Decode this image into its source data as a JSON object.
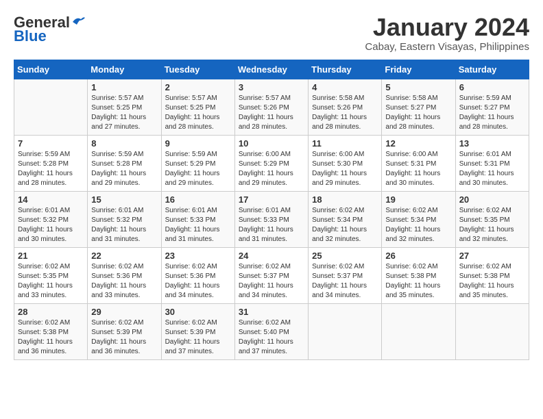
{
  "header": {
    "logo_line1": "General",
    "logo_line2": "Blue",
    "month": "January 2024",
    "location": "Cabay, Eastern Visayas, Philippines"
  },
  "weekdays": [
    "Sunday",
    "Monday",
    "Tuesday",
    "Wednesday",
    "Thursday",
    "Friday",
    "Saturday"
  ],
  "weeks": [
    [
      {
        "day": "",
        "info": ""
      },
      {
        "day": "1",
        "info": "Sunrise: 5:57 AM\nSunset: 5:25 PM\nDaylight: 11 hours\nand 27 minutes."
      },
      {
        "day": "2",
        "info": "Sunrise: 5:57 AM\nSunset: 5:25 PM\nDaylight: 11 hours\nand 28 minutes."
      },
      {
        "day": "3",
        "info": "Sunrise: 5:57 AM\nSunset: 5:26 PM\nDaylight: 11 hours\nand 28 minutes."
      },
      {
        "day": "4",
        "info": "Sunrise: 5:58 AM\nSunset: 5:26 PM\nDaylight: 11 hours\nand 28 minutes."
      },
      {
        "day": "5",
        "info": "Sunrise: 5:58 AM\nSunset: 5:27 PM\nDaylight: 11 hours\nand 28 minutes."
      },
      {
        "day": "6",
        "info": "Sunrise: 5:59 AM\nSunset: 5:27 PM\nDaylight: 11 hours\nand 28 minutes."
      }
    ],
    [
      {
        "day": "7",
        "info": "Sunrise: 5:59 AM\nSunset: 5:28 PM\nDaylight: 11 hours\nand 28 minutes."
      },
      {
        "day": "8",
        "info": "Sunrise: 5:59 AM\nSunset: 5:28 PM\nDaylight: 11 hours\nand 29 minutes."
      },
      {
        "day": "9",
        "info": "Sunrise: 5:59 AM\nSunset: 5:29 PM\nDaylight: 11 hours\nand 29 minutes."
      },
      {
        "day": "10",
        "info": "Sunrise: 6:00 AM\nSunset: 5:29 PM\nDaylight: 11 hours\nand 29 minutes."
      },
      {
        "day": "11",
        "info": "Sunrise: 6:00 AM\nSunset: 5:30 PM\nDaylight: 11 hours\nand 29 minutes."
      },
      {
        "day": "12",
        "info": "Sunrise: 6:00 AM\nSunset: 5:31 PM\nDaylight: 11 hours\nand 30 minutes."
      },
      {
        "day": "13",
        "info": "Sunrise: 6:01 AM\nSunset: 5:31 PM\nDaylight: 11 hours\nand 30 minutes."
      }
    ],
    [
      {
        "day": "14",
        "info": "Sunrise: 6:01 AM\nSunset: 5:32 PM\nDaylight: 11 hours\nand 30 minutes."
      },
      {
        "day": "15",
        "info": "Sunrise: 6:01 AM\nSunset: 5:32 PM\nDaylight: 11 hours\nand 31 minutes."
      },
      {
        "day": "16",
        "info": "Sunrise: 6:01 AM\nSunset: 5:33 PM\nDaylight: 11 hours\nand 31 minutes."
      },
      {
        "day": "17",
        "info": "Sunrise: 6:01 AM\nSunset: 5:33 PM\nDaylight: 11 hours\nand 31 minutes."
      },
      {
        "day": "18",
        "info": "Sunrise: 6:02 AM\nSunset: 5:34 PM\nDaylight: 11 hours\nand 32 minutes."
      },
      {
        "day": "19",
        "info": "Sunrise: 6:02 AM\nSunset: 5:34 PM\nDaylight: 11 hours\nand 32 minutes."
      },
      {
        "day": "20",
        "info": "Sunrise: 6:02 AM\nSunset: 5:35 PM\nDaylight: 11 hours\nand 32 minutes."
      }
    ],
    [
      {
        "day": "21",
        "info": "Sunrise: 6:02 AM\nSunset: 5:35 PM\nDaylight: 11 hours\nand 33 minutes."
      },
      {
        "day": "22",
        "info": "Sunrise: 6:02 AM\nSunset: 5:36 PM\nDaylight: 11 hours\nand 33 minutes."
      },
      {
        "day": "23",
        "info": "Sunrise: 6:02 AM\nSunset: 5:36 PM\nDaylight: 11 hours\nand 34 minutes."
      },
      {
        "day": "24",
        "info": "Sunrise: 6:02 AM\nSunset: 5:37 PM\nDaylight: 11 hours\nand 34 minutes."
      },
      {
        "day": "25",
        "info": "Sunrise: 6:02 AM\nSunset: 5:37 PM\nDaylight: 11 hours\nand 34 minutes."
      },
      {
        "day": "26",
        "info": "Sunrise: 6:02 AM\nSunset: 5:38 PM\nDaylight: 11 hours\nand 35 minutes."
      },
      {
        "day": "27",
        "info": "Sunrise: 6:02 AM\nSunset: 5:38 PM\nDaylight: 11 hours\nand 35 minutes."
      }
    ],
    [
      {
        "day": "28",
        "info": "Sunrise: 6:02 AM\nSunset: 5:38 PM\nDaylight: 11 hours\nand 36 minutes."
      },
      {
        "day": "29",
        "info": "Sunrise: 6:02 AM\nSunset: 5:39 PM\nDaylight: 11 hours\nand 36 minutes."
      },
      {
        "day": "30",
        "info": "Sunrise: 6:02 AM\nSunset: 5:39 PM\nDaylight: 11 hours\nand 37 minutes."
      },
      {
        "day": "31",
        "info": "Sunrise: 6:02 AM\nSunset: 5:40 PM\nDaylight: 11 hours\nand 37 minutes."
      },
      {
        "day": "",
        "info": ""
      },
      {
        "day": "",
        "info": ""
      },
      {
        "day": "",
        "info": ""
      }
    ]
  ]
}
